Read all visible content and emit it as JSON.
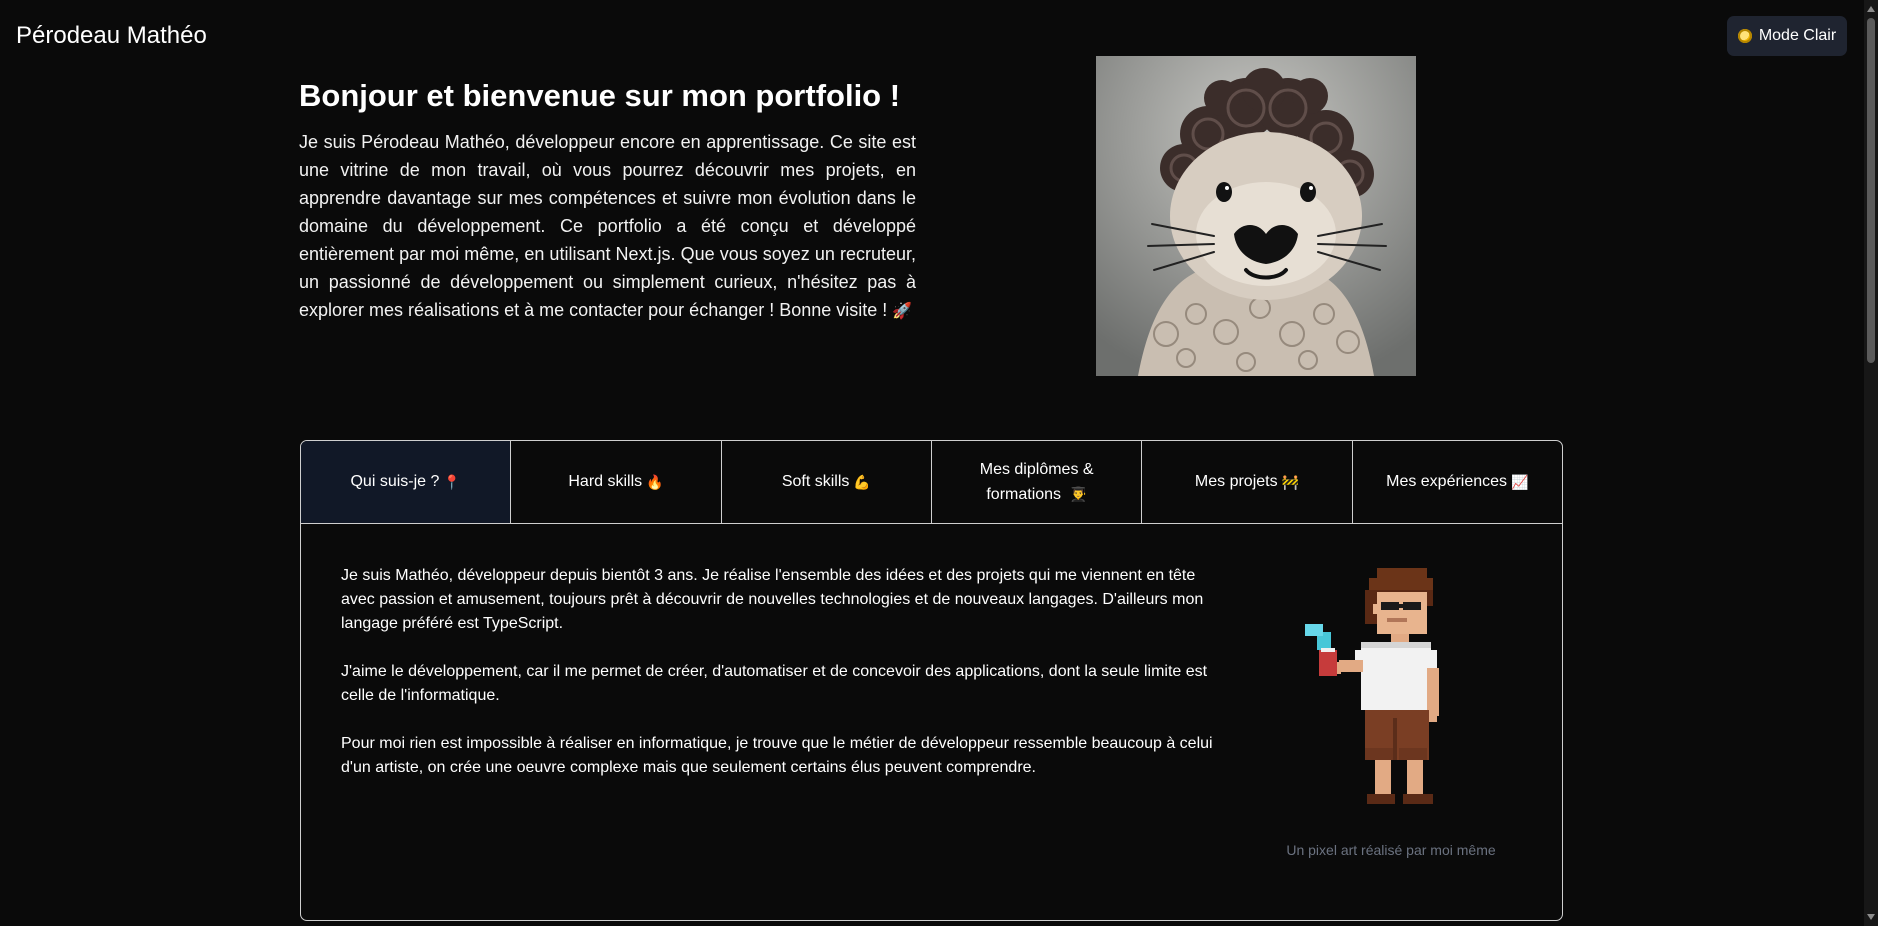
{
  "header": {
    "brand": "Pérodeau Mathéo",
    "theme_button": {
      "label": "Mode Clair",
      "icon": "sun-icon"
    }
  },
  "hero": {
    "title": "Bonjour et bienvenue sur mon portfolio !",
    "text": "Je suis Pérodeau Mathéo, développeur encore en apprentissage. Ce site est une vitrine de mon travail, où vous pourrez découvrir mes projets, en apprendre davantage sur mes compétences et suivre mon évolution dans le domaine du développement. Ce portfolio a été conçu et développé entièrement par moi même, en utilisant Next.js. Que vous soyez un recruteur, un passionné de développement ou simplement curieux, n'hésitez pas à explorer mes réalisations et à me contacter pour échanger ! Bonne visite !",
    "text_emoji": "🚀",
    "portrait": "otter-portrait-image"
  },
  "tabs": [
    {
      "label": "Qui suis-je ?",
      "emoji": "📍"
    },
    {
      "label": "Hard skills",
      "emoji": "🔥"
    },
    {
      "label": "Soft skills",
      "emoji": "💪"
    },
    {
      "label": "Mes diplômes &",
      "label_line2": "formations",
      "emoji": "👨‍🎓"
    },
    {
      "label": "Mes projets",
      "emoji": "🚧"
    },
    {
      "label": "Mes expériences",
      "emoji": "📈"
    }
  ],
  "active_tab": "Qui suis-je ?",
  "about_panel": {
    "paragraphs": [
      "Je suis Mathéo, développeur depuis bientôt 3 ans. Je réalise l'ensemble des idées et des projets qui me viennent en tête avec passion et amusement, toujours prêt à découvrir de nouvelles technologies et de nouveaux langages. D'ailleurs mon langage préféré est TypeScript.",
      "J'aime le développement, car il me permet de créer, d'automatiser et de concevoir des applications, dont la seule limite est celle de l'informatique.",
      "Pour moi rien est impossible à réaliser en informatique, je trouve que le métier de développeur ressemble beaucoup à celui d'un artiste, on crée une oeuvre complexe mais que seulement certains élus peuvent comprendre."
    ],
    "pixel_art": "pixel-art-character-image",
    "caption": "Un pixel art réalisé par moi même"
  },
  "colors": {
    "background": "#0a0a0a",
    "text": "#f2f2f2",
    "active_tab": "#111827",
    "button": "#1f2430",
    "caption": "#6b7280",
    "border": "#cfcfcf"
  }
}
